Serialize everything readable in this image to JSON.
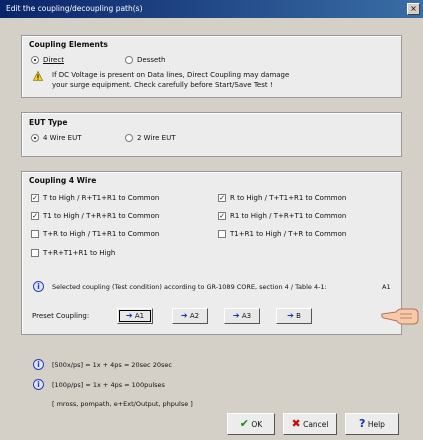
{
  "window": {
    "title": "Edit the coupling/decoupling path(s)",
    "close": "×"
  },
  "coupling_elements": {
    "title": "Coupling Elements",
    "options": [
      {
        "label": "Direct",
        "selected": true
      },
      {
        "label": "Desseth",
        "selected": false
      }
    ],
    "warning_line1": "If DC Voltage is present on Data lines, Direct Coupling may damage",
    "warning_line2": "your surge equipment.  Check carefully before Start/Save Test !"
  },
  "eut_type": {
    "title": "EUT Type",
    "options": [
      {
        "label": "4 Wire EUT",
        "selected": true
      },
      {
        "label": "2 Wire EUT",
        "selected": false
      }
    ]
  },
  "coupling_4wire": {
    "title": "Coupling 4 Wire",
    "checks": [
      {
        "label": "T  to High  /  R+T1+R1  to Common",
        "checked": true
      },
      {
        "label": "R  to High  /  T+T1+R1  to Common",
        "checked": true
      },
      {
        "label": "T1  to High  /  T+R+R1  to Common",
        "checked": true
      },
      {
        "label": "R1  to High  /  T+R+T1  to Common",
        "checked": true
      },
      {
        "label": "T+R  to High  /  T1+R1  to Common",
        "checked": false
      },
      {
        "label": "T1+R1  to High  /  T+R  to Common",
        "checked": false
      },
      {
        "label": "T+R+T1+R1  to High",
        "checked": false
      }
    ],
    "selected_text": "Selected coupling (Test condition) according to GR-1089 CORE, section 4 / Table 4-1:",
    "selected_value": "A1",
    "preset_label": "Preset Coupling:",
    "presets": [
      {
        "label": "A1",
        "active": true
      },
      {
        "label": "A2",
        "active": false
      },
      {
        "label": "A3",
        "active": false
      },
      {
        "label": "B",
        "active": false
      }
    ]
  },
  "notes": {
    "line1": "[500x/ps] = 1x + 4ps = 20sec 20sec",
    "line2": "[100p/ps] = 1x + 4ps = 100pulses",
    "line3": "[ mross, pompath, e+Ext/Output, phpulse ]"
  },
  "buttons": {
    "ok": "OK",
    "cancel": "Cancel",
    "help": "Help"
  },
  "colors": {
    "titlebar": "#0a246a",
    "accent": "#1a2fa8",
    "ok_check": "#1e8a1e",
    "cancel_x": "#c01010"
  }
}
